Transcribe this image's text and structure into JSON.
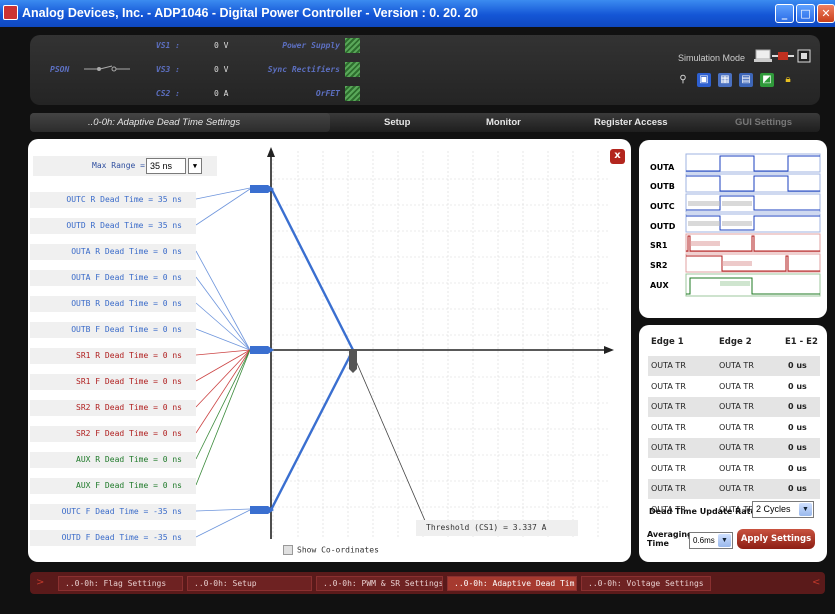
{
  "window": {
    "title": "Analog Devices, Inc. - ADP1046 - Digital Power Controller - Version : 0. 20. 20"
  },
  "header": {
    "pson_label": "PSON",
    "signals": [
      {
        "label": "VS1 :",
        "value": "0 V"
      },
      {
        "label": "VS3 :",
        "value": "0 V"
      },
      {
        "label": "CS2 :",
        "value": "0 A"
      }
    ],
    "indicators": [
      "Power Supply",
      "Sync Rectifiers",
      "OrFET"
    ],
    "simulation_mode": "Simulation Mode",
    "toolbar_icons": [
      "search-icon",
      "save-icon",
      "table-icon",
      "export-icon",
      "chart-icon",
      "lock-icon"
    ]
  },
  "nav": {
    "active": "..0-0h: Adaptive Dead Time Settings",
    "items": [
      "Setup",
      "Monitor",
      "Register Access",
      "GUI Settings"
    ]
  },
  "deadtime": {
    "max_range_label": "Max Range =",
    "max_range_value": "35 ns",
    "labels": [
      {
        "text": "OUTC R Dead Time = 35 ns",
        "color": "#3a6bc9"
      },
      {
        "text": "OUTD R Dead Time = 35 ns",
        "color": "#3a6bc9"
      },
      {
        "text": "OUTA R Dead Time = 0 ns",
        "color": "#3a6bc9"
      },
      {
        "text": "OUTA F Dead Time = 0 ns",
        "color": "#3a6bc9"
      },
      {
        "text": "OUTB R Dead Time = 0 ns",
        "color": "#3a6bc9"
      },
      {
        "text": "OUTB F Dead Time = 0 ns",
        "color": "#3a6bc9"
      },
      {
        "text": "SR1 R Dead Time = 0 ns",
        "color": "#b02020"
      },
      {
        "text": "SR1 F Dead Time = 0 ns",
        "color": "#b02020"
      },
      {
        "text": "SR2 R Dead Time = 0 ns",
        "color": "#b02020"
      },
      {
        "text": "SR2 F Dead Time = 0 ns",
        "color": "#b02020"
      },
      {
        "text": "AUX R Dead Time = 0 ns",
        "color": "#1f7a2a"
      },
      {
        "text": "AUX F Dead Time = 0 ns",
        "color": "#1f7a2a"
      },
      {
        "text": "OUTC F Dead Time = -35 ns",
        "color": "#3a6bc9"
      },
      {
        "text": "OUTD F Dead Time = -35 ns",
        "color": "#3a6bc9"
      }
    ],
    "threshold": "Threshold (CS1) = 3.337 A",
    "show_coordinates": "Show Co-ordinates",
    "close_label": "x"
  },
  "waveforms": [
    {
      "name": "OUTA",
      "color": "#1a3fbf"
    },
    {
      "name": "OUTB",
      "color": "#1a3fbf"
    },
    {
      "name": "OUTC",
      "color": "#1a3fbf"
    },
    {
      "name": "OUTD",
      "color": "#1a3fbf"
    },
    {
      "name": "SR1",
      "color": "#b01818"
    },
    {
      "name": "SR2",
      "color": "#b01818"
    },
    {
      "name": "AUX",
      "color": "#1c7a20"
    }
  ],
  "edges": {
    "headers": [
      "Edge 1",
      "Edge 2",
      "E1 - E2"
    ],
    "rows": [
      [
        "OUTA TR",
        "OUTA TR",
        "0 us"
      ],
      [
        "OUTA TR",
        "OUTA TR",
        "0 us"
      ],
      [
        "OUTA TR",
        "OUTA TR",
        "0 us"
      ],
      [
        "OUTA TR",
        "OUTA TR",
        "0 us"
      ],
      [
        "OUTA TR",
        "OUTA TR",
        "0 us"
      ],
      [
        "OUTA TR",
        "OUTA TR",
        "0 us"
      ],
      [
        "OUTA TR",
        "OUTA TR",
        "0 us"
      ],
      [
        "OUTA TR",
        "OUTA TR",
        "0 us"
      ]
    ],
    "update_rate_label": "Dead Time Update Rate",
    "update_rate_value": "2 Cycles",
    "averaging_label_1": "Averaging",
    "averaging_label_2": "Time",
    "averaging_value": "0.6ms",
    "apply_label": "Apply Settings"
  },
  "bottom_tabs": [
    "..0-0h: Flag Settings",
    "..0-0h: Setup",
    "..0-0h: PWM & SR Settings",
    "..0-0h: Adaptive Dead Tim",
    "..0-0h: Voltage Settings"
  ],
  "bottom_active_index": 3
}
